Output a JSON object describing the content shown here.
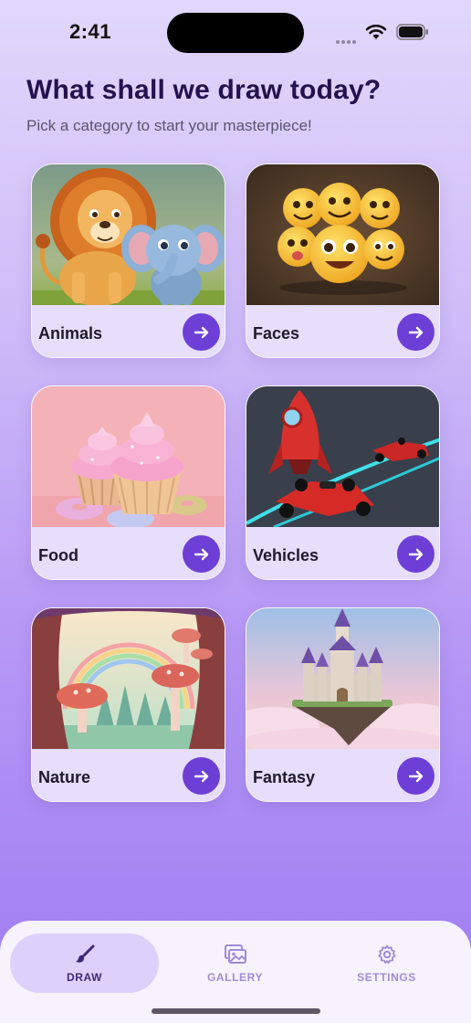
{
  "status_bar": {
    "time": "2:41"
  },
  "header": {
    "title": "What shall we draw today?",
    "subtitle": "Pick a category to start your masterpiece!"
  },
  "categories": [
    {
      "label": "Animals",
      "image": "lion-and-elephant-illustration"
    },
    {
      "label": "Faces",
      "image": "emoji-faces-illustration"
    },
    {
      "label": "Food",
      "image": "cupcakes-and-donuts-illustration"
    },
    {
      "label": "Vehicles",
      "image": "rocket-and-race-cars-illustration"
    },
    {
      "label": "Nature",
      "image": "mushroom-forest-rainbow-illustration"
    },
    {
      "label": "Fantasy",
      "image": "floating-castle-illustration"
    }
  ],
  "tab_bar": {
    "tabs": [
      {
        "label": "DRAW",
        "icon": "brush-icon",
        "selected": true
      },
      {
        "label": "GALLERY",
        "icon": "gallery-icon",
        "selected": false
      },
      {
        "label": "SETTINGS",
        "icon": "gear-icon",
        "selected": false
      }
    ]
  },
  "colors": {
    "accent": "#6d3fd6",
    "title": "#24124f",
    "selected_tab_bg": "#ddd1fb",
    "inactive_tab": "#a28bd8"
  }
}
